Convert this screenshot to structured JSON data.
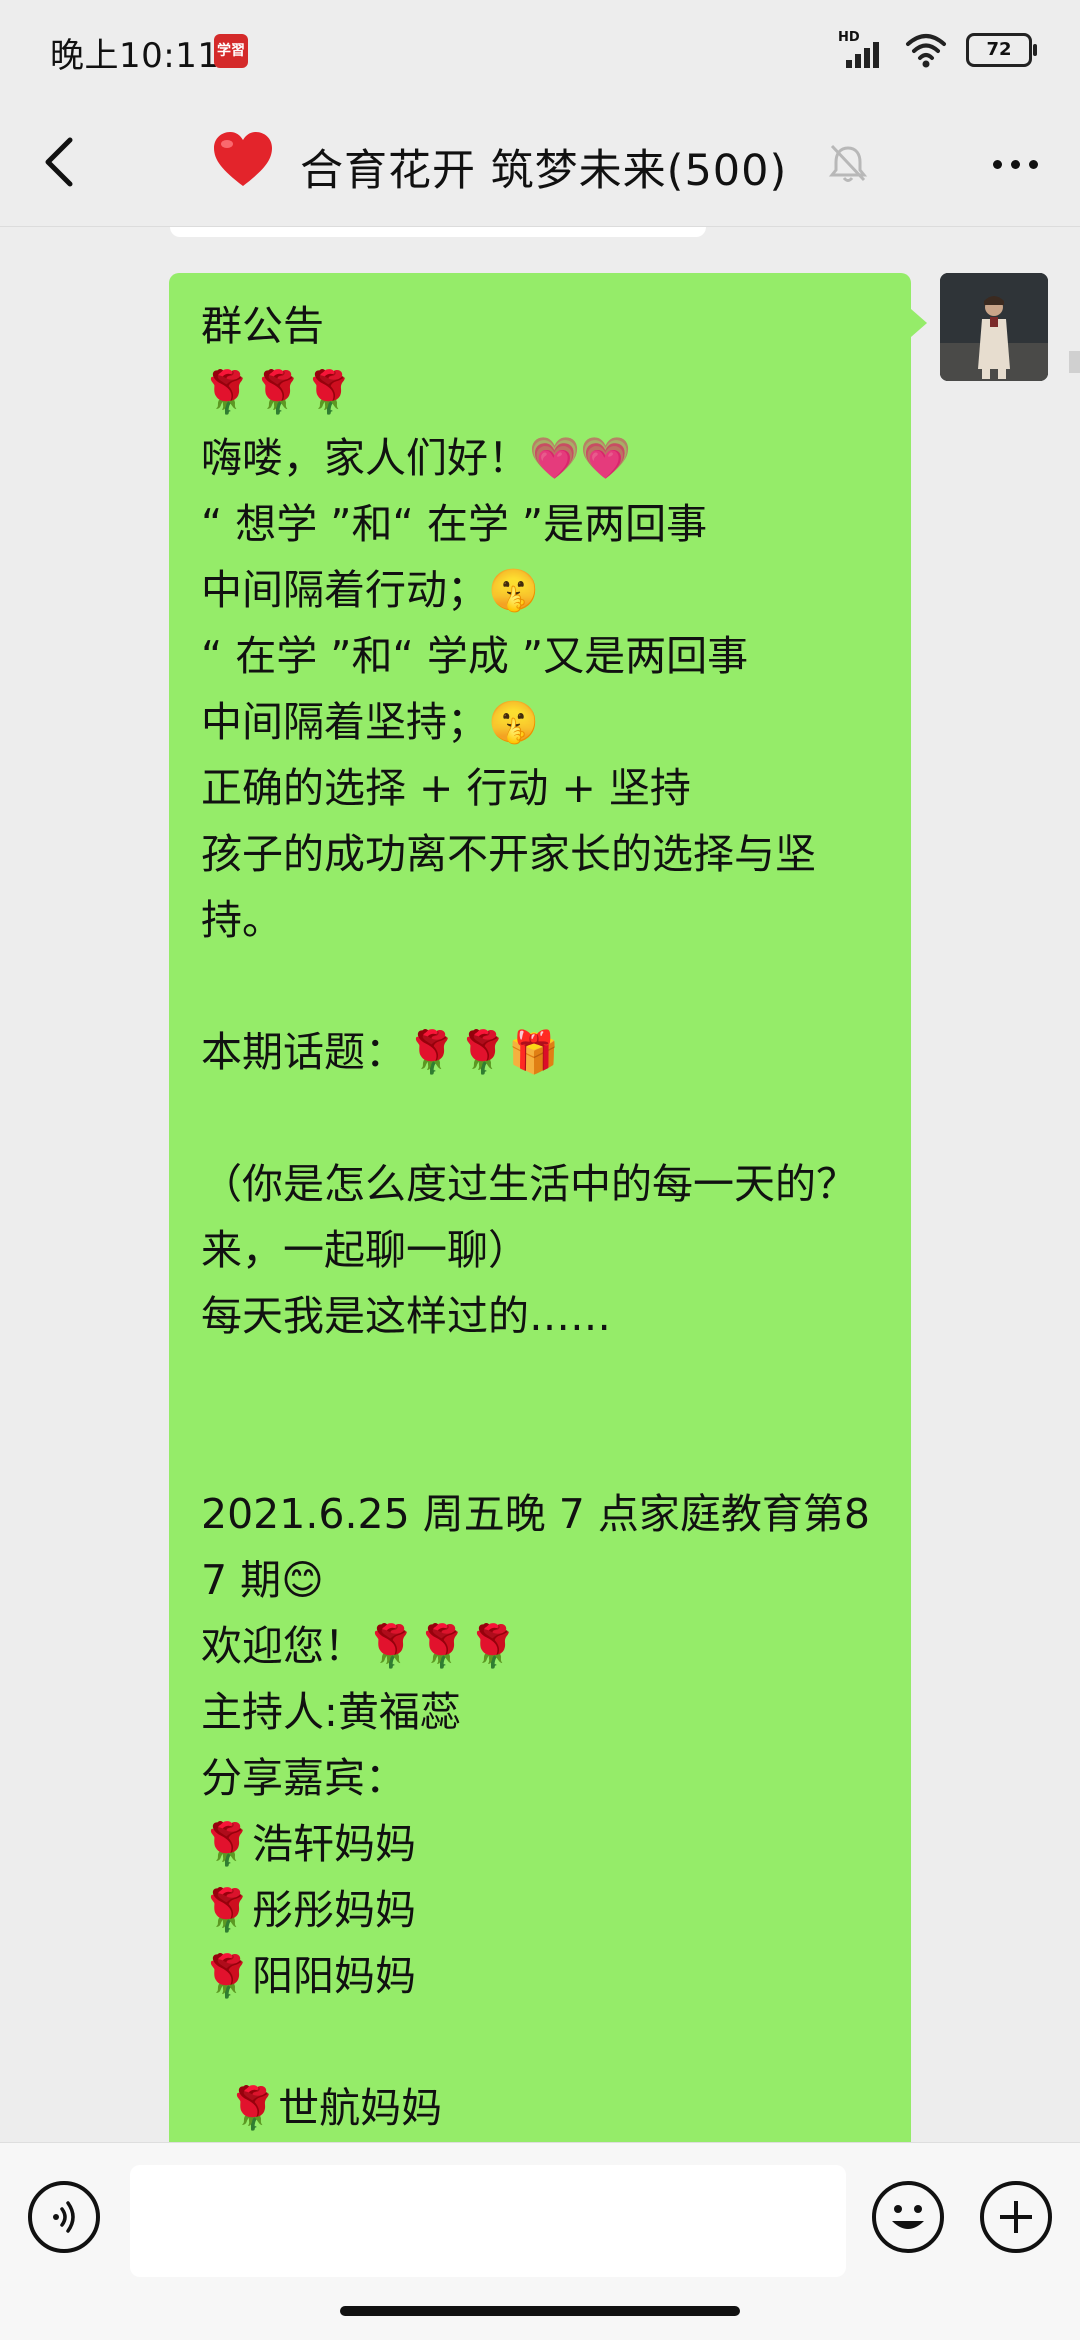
{
  "status_bar": {
    "time": "晚上10:11",
    "app_badge": "学習",
    "network_label": "HD",
    "battery": "72"
  },
  "header": {
    "title_emoji": "❤️",
    "title": "合育花开 筑梦未来(500)",
    "icons": [
      "back-arrow-icon",
      "heart-icon",
      "mute-bell-icon",
      "more-icon"
    ]
  },
  "message": {
    "text": "群公告\n🌹🌹🌹\n嗨喽，家人们好！💗💗\n“ 想学 ”和“ 在学 ”是两回事\n中间隔着行动；🤫\n“ 在学 ”和“ 学成 ”又是两回事\n中间隔着坚持；🤫\n正确的选择 + 行动 + 坚持\n孩子的成功离不开家长的选择与坚持。\n\n本期话题：🌹🌹🎁\n\n（你是怎么度过生活中的每一天的？来，一起聊一聊）\n每天我是这样过的……\n\n\n2021.6.25 周五晚 7 点家庭教育第87 期😊\n欢迎您！🌹🌹🌹\n主持人:黄福蕊\n分享嘉宾：\n🌹浩轩妈妈\n🌹彤彤妈妈\n🌹阳阳妈妈\n\n  🌹世航妈妈"
  },
  "input_bar": {
    "placeholder": "",
    "icons": [
      "voice-icon",
      "emoji-icon",
      "plus-icon"
    ]
  }
}
